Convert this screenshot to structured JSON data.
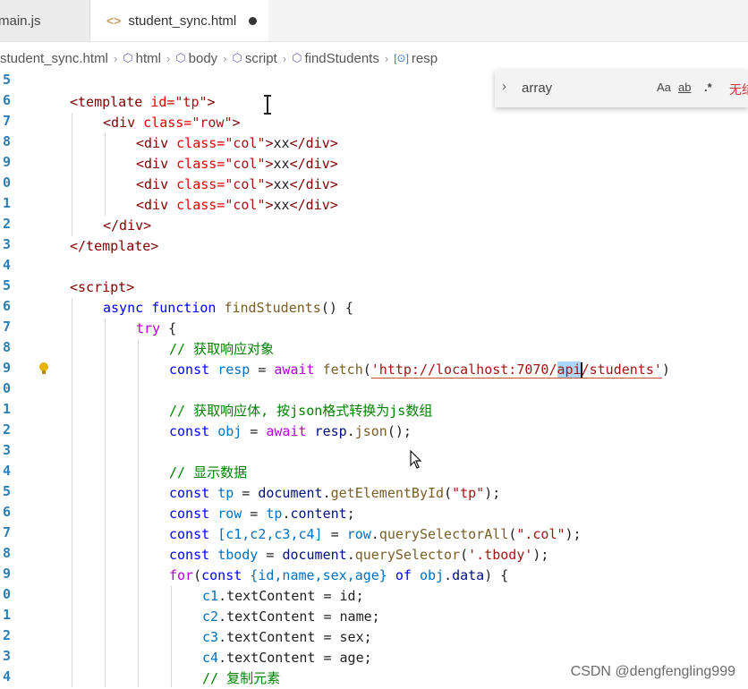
{
  "tabs": [
    {
      "label": "main.js",
      "active": false
    },
    {
      "label": "student_sync.html",
      "active": true,
      "modified": true,
      "icon": "<>"
    }
  ],
  "breadcrumb": [
    "student_sync.html",
    "html",
    "body",
    "script",
    "findStudents",
    "resp"
  ],
  "find_widget": {
    "query": "array",
    "options": [
      "Aa",
      "ab",
      ".*"
    ],
    "result_text": "无结"
  },
  "line_numbers": [
    "5",
    "6",
    "7",
    "8",
    "9",
    "0",
    "1",
    "2",
    "3",
    "4",
    "5",
    "6",
    "7",
    "8",
    "9",
    "0",
    "1",
    "2",
    "3",
    "4",
    "5",
    "6",
    "7",
    "8",
    "9",
    "0",
    "1",
    "2",
    "3",
    "4"
  ],
  "code": {
    "l6_tag": "<template ",
    "l6_attr": "id=",
    "l6_val": "\"tp\"",
    "l6_end": ">",
    "l7_open": "<div ",
    "l7_attr": "class=",
    "l7_val": "\"row\"",
    "l7_end": ">",
    "col_open": "<div ",
    "col_attr": "class=",
    "col_val": "\"col\"",
    "col_end": ">",
    "col_text": "xx",
    "col_close": "</div>",
    "l12": "</div>",
    "l13": "</template>",
    "l15": "<script>",
    "l16_async": "async",
    "l16_function": "function",
    "l16_name": "findStudents",
    "l16_rest": "() {",
    "l17_try": "try",
    "l17_rest": " {",
    "l18": "// 获取响应对象",
    "l19_const": "const",
    "l19_var": "resp",
    "l19_eq": " = ",
    "l19_await": "await",
    "l19_fetch": "fetch",
    "l19_paren": "(",
    "l19_url_a": "'http://localhost:7070/",
    "l19_url_hl": "api",
    "l19_url_b": "/students'",
    "l19_close": ")",
    "l21": "// 获取响应体, 按json格式转换为js数组",
    "l22_const": "const",
    "l22_var": "obj",
    "l22_eq": " = ",
    "l22_await": "await",
    "l22_obj": "resp",
    "l22_dot": ".",
    "l22_fn": "json",
    "l22_end": "();",
    "l24": "// 显示数据",
    "l25_const": "const",
    "l25_var": "tp",
    "l25_eq": " = ",
    "l25_obj": "document",
    "l25_dot": ".",
    "l25_fn": "getElementById",
    "l25_p": "(",
    "l25_str": "\"tp\"",
    "l25_end": ");",
    "l26_const": "const",
    "l26_var": "row",
    "l26_eq": " = ",
    "l26_obj": "tp",
    "l26_dot": ".",
    "l26_prop": "content",
    "l26_end": ";",
    "l27_const": "const",
    "l27_destr": "[c1,c2,c3,c4]",
    "l27_eq": " = ",
    "l27_obj": "row",
    "l27_dot": ".",
    "l27_fn": "querySelectorAll",
    "l27_p": "(",
    "l27_str": "\".col\"",
    "l27_end": ");",
    "l28_const": "const",
    "l28_var": "tbody",
    "l28_eq": " = ",
    "l28_obj": "document",
    "l28_dot": ".",
    "l28_fn": "querySelector",
    "l28_p": "(",
    "l28_str": "'.tbody'",
    "l28_end": ");",
    "l29_for": "for",
    "l29_p": "(",
    "l29_const": "const",
    "l29_destr": " {id,name,sex,age} ",
    "l29_of": "of",
    "l29_obj": " obj",
    "l29_dot": ".",
    "l29_prop": "data",
    "l29_end": ") {",
    "l30_obj": "c1",
    "l30_rest": ".textContent = id;",
    "l31_obj": "c2",
    "l31_rest": ".textContent = name;",
    "l32_obj": "c3",
    "l32_rest": ".textContent = sex;",
    "l33_obj": "c4",
    "l33_rest": ".textContent = age;",
    "l34": "// 复制元素"
  },
  "watermark": "CSDN @dengfengling999",
  "colors": {
    "keyword": "#0000ff",
    "tag": "#800000",
    "attribute": "#e50000",
    "string": "#a31515",
    "comment": "#008000",
    "function": "#795e26",
    "variable": "#001080",
    "control": "#af00db",
    "line_number": "#2e7fb5",
    "selection": "#add6ff"
  }
}
